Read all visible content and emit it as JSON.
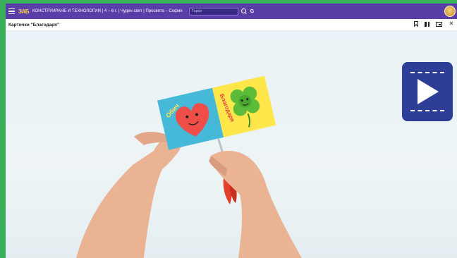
{
  "header": {
    "logo": "ЗАБ",
    "title": "КОНСТРУИРАНЕ И ТЕХНОЛОГИИ | 4 – 6 г. | Чуден свят | Просвета – София",
    "search_placeholder": "Търси",
    "g_label": "G"
  },
  "lesson": {
    "title": "Картички \"Благодаря\""
  },
  "video": {
    "card_left_text": "Обич",
    "card_right_text": "Благодаря"
  },
  "colors": {
    "page_background": "#3bb05a",
    "topbar": "#5a3ea8",
    "play_button": "#2d3e96",
    "card_blue": "#46b8d8",
    "card_yellow": "#ffe64a",
    "heart": "#ef4d48",
    "clover": "#5cbc3a",
    "scissors_handle": "#e0402c"
  },
  "icons": {
    "menu": "hamburger-menu-icon",
    "search": "search-icon",
    "profile": "profile-avatar-icon",
    "bookmark": "bookmark-icon",
    "pause": "pause-icon",
    "pip": "picture-in-picture-icon",
    "close": "close-icon",
    "play": "play-icon"
  }
}
